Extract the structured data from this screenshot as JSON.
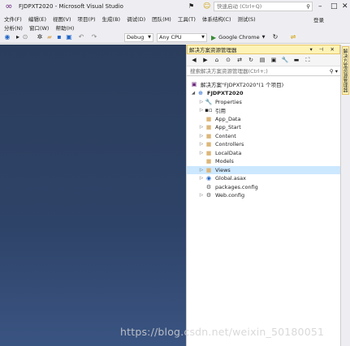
{
  "window": {
    "title": "FJDPXT2020 - Microsoft Visual Studio",
    "quick_launch_placeholder": "快速启动 (Ctrl+Q)",
    "login_label": "登录"
  },
  "menu": {
    "row1": [
      "文件(F)",
      "编辑(E)",
      "视图(V)",
      "项目(P)",
      "生成(B)",
      "调试(D)",
      "团队(M)",
      "工具(T)",
      "体系结构(C)",
      "测试(S)"
    ],
    "row2": [
      "分析(N)",
      "窗口(W)",
      "帮助(H)"
    ]
  },
  "toolbar": {
    "config": "Debug",
    "platform": "Any CPU",
    "run_target": "Google Chrome"
  },
  "solution_explorer": {
    "title": "解决方案资源管理器",
    "search_placeholder": "搜索解决方案资源管理器(Ctrl+;)",
    "side_tab_label": "解决方案资源管理器",
    "tree": [
      {
        "label": "解决方案\"FJDPXT2020\"(1 个项目)",
        "icon": "solution-icon",
        "level": 0,
        "expander": ""
      },
      {
        "label": "FJDPXT2020",
        "icon": "web-project-icon",
        "level": 1,
        "expander": "expanded"
      },
      {
        "label": "Properties",
        "icon": "wrench-icon",
        "level": 2,
        "expander": "collapsed"
      },
      {
        "label": "引用",
        "icon": "references-icon",
        "level": 2,
        "expander": "collapsed"
      },
      {
        "label": "App_Data",
        "icon": "folder-icon",
        "level": 2,
        "expander": ""
      },
      {
        "label": "App_Start",
        "icon": "folder-icon",
        "level": 2,
        "expander": "collapsed"
      },
      {
        "label": "Content",
        "icon": "folder-icon",
        "level": 2,
        "expander": "collapsed"
      },
      {
        "label": "Controllers",
        "icon": "folder-icon",
        "level": 2,
        "expander": "collapsed"
      },
      {
        "label": "LocalData",
        "icon": "folder-icon",
        "level": 2,
        "expander": "collapsed"
      },
      {
        "label": "Models",
        "icon": "folder-icon",
        "level": 2,
        "expander": ""
      },
      {
        "label": "Views",
        "icon": "folder-icon",
        "level": 2,
        "expander": "collapsed",
        "selected": true
      },
      {
        "label": "Global.asax",
        "icon": "global-asax-icon",
        "level": 2,
        "expander": "collapsed"
      },
      {
        "label": "packages.config",
        "icon": "config-file-icon",
        "level": 2,
        "expander": ""
      },
      {
        "label": "Web.config",
        "icon": "config-file-icon",
        "level": 2,
        "expander": "collapsed"
      }
    ]
  },
  "watermark": "https://blog.csdn.net/weixin_50180051",
  "colors": {
    "chrome_bg": "#eeeef2",
    "editor_bg": "#2e4368",
    "selection": "#cce8ff",
    "panel_header": "#fdf3b6",
    "folder": "#dcb67a"
  }
}
